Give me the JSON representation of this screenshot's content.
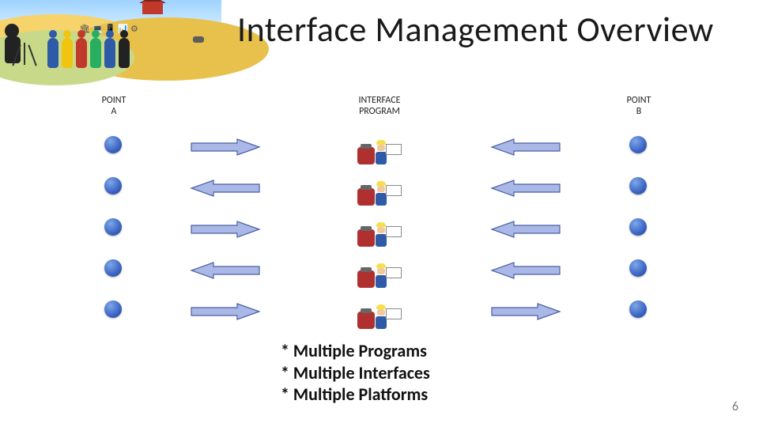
{
  "title": "Interface Management Overview",
  "columns": {
    "point_a": "POINT\nA",
    "interface_program": "INTERFACE\nPROGRAM",
    "point_b": "POINT\nB"
  },
  "rows": [
    {
      "left_arrow_dir": "right",
      "right_arrow_dir": "left"
    },
    {
      "left_arrow_dir": "left",
      "right_arrow_dir": "left"
    },
    {
      "left_arrow_dir": "right",
      "right_arrow_dir": "left"
    },
    {
      "left_arrow_dir": "left",
      "right_arrow_dir": "left"
    },
    {
      "left_arrow_dir": "right",
      "right_arrow_dir": "right"
    }
  ],
  "notes": [
    "* Multiple Programs",
    "* Multiple Interfaces",
    "* Multiple Platforms"
  ],
  "page_number": "6",
  "colors": {
    "arrow_fill": "#a9b8e6",
    "arrow_stroke": "#4a5fa5",
    "dot_fill": "#3b64c4"
  }
}
